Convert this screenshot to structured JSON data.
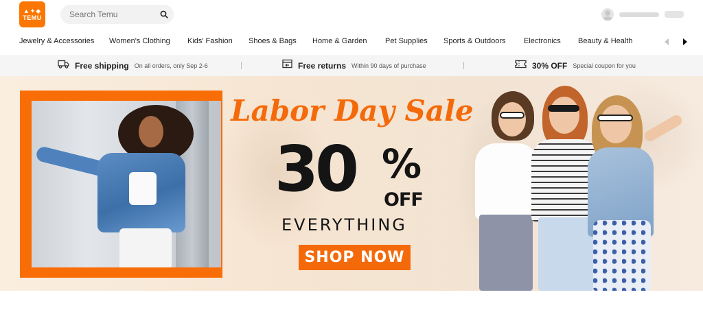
{
  "header": {
    "logo": {
      "glyphs": "▲✦◆",
      "wordmark": "TEMU",
      "icon": "temu-logo-icon"
    },
    "search": {
      "placeholder": "Search Temu",
      "icon": "search-icon"
    },
    "account": {
      "icon": "user-avatar-icon"
    }
  },
  "categories": {
    "items": [
      "Jewelry & Accessories",
      "Women's Clothing",
      "Kids' Fashion",
      "Shoes & Bags",
      "Home & Garden",
      "Pet Supplies",
      "Sports & Outdoors",
      "Electronics",
      "Beauty & Health"
    ],
    "prev_icon": "chevron-left-icon",
    "next_icon": "chevron-right-icon"
  },
  "benefits": [
    {
      "icon": "truck-icon",
      "title": "Free shipping",
      "sub": "On all orders, only Sep 2-6"
    },
    {
      "icon": "return-box-icon",
      "title": "Free returns",
      "sub": "Within 90 days of purchase"
    },
    {
      "icon": "coupon-icon",
      "title": "30% OFF",
      "sub": "Special coupon for you"
    }
  ],
  "banner": {
    "title": "Labor Day Sale",
    "percent": "30",
    "percent_sign": "%",
    "off": "OFF",
    "everything": "EVERYTHING",
    "cta": "SHOP NOW"
  },
  "colors": {
    "brand_orange": "#fb7701",
    "banner_orange": "#f46a0a",
    "benefits_bg": "#f5f5f5"
  }
}
